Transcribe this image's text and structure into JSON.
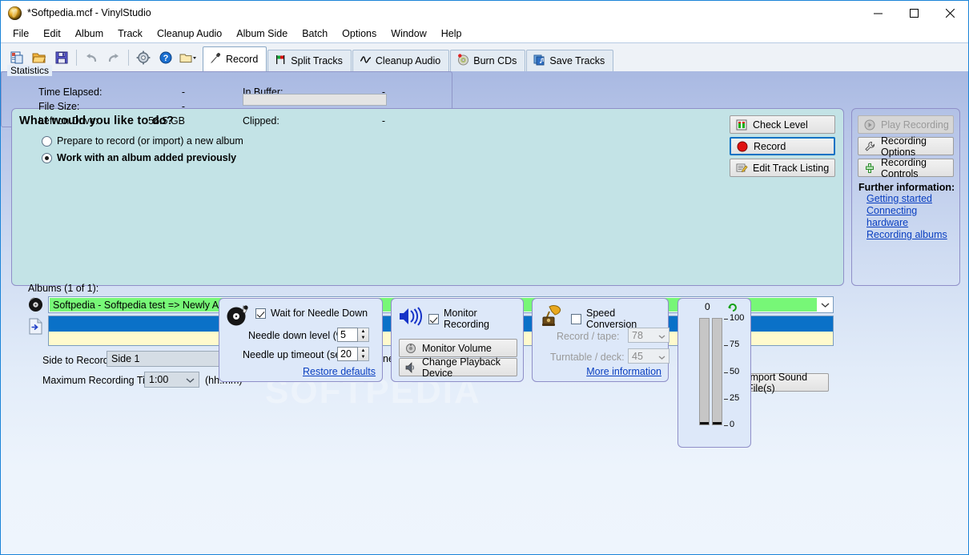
{
  "window": {
    "title": "*Softpedia.mcf - VinylStudio",
    "app_icon": "vinyl-record-icon",
    "minimize": "–",
    "maximize": "□",
    "close": "×"
  },
  "menubar": {
    "items": [
      "File",
      "Edit",
      "Album",
      "Track",
      "Cleanup Audio",
      "Album Side",
      "Batch",
      "Options",
      "Window",
      "Help"
    ]
  },
  "toolbar": {
    "icons": [
      "new-document-icon",
      "open-folder-icon",
      "save-disk-icon",
      "undo-icon",
      "redo-icon",
      "settings-gear-icon",
      "help-question-icon",
      "folder-dropdown-icon"
    ],
    "tabs": [
      {
        "label": "Record",
        "icon": "microphone-icon",
        "active": true
      },
      {
        "label": "Split Tracks",
        "icon": "flags-icon",
        "active": false
      },
      {
        "label": "Cleanup Audio",
        "icon": "waveform-icon",
        "active": false
      },
      {
        "label": "Burn CDs",
        "icon": "cd-burn-icon",
        "active": false
      },
      {
        "label": "Save Tracks",
        "icon": "save-tracks-icon",
        "active": false
      }
    ]
  },
  "task_panel": {
    "heading": "What would you like to do?",
    "option_new": "Prepare to record (or import) a new album",
    "option_existing": "Work with an album added previously",
    "albums_label": "Albums (1 of 1):",
    "album_selected": "Softpedia - Softpedia test => Newly Added",
    "side_to_record_label": "Side to Record:",
    "side_to_record_value": "Side 1",
    "record_all_sides_label": "Record all sides as one file",
    "max_recording_time_label": "Maximum Recording Time:",
    "max_recording_time_value": "1:00",
    "hhmm": "(hh:mm)",
    "import_button": "Import Sound File(s)",
    "buttons": [
      {
        "label": "Check Level",
        "icon": "level-meter-icon"
      },
      {
        "label": "Record",
        "icon": "record-dot-icon"
      },
      {
        "label": "Edit Track Listing",
        "icon": "edit-list-icon"
      }
    ]
  },
  "info_panel": {
    "buttons": [
      {
        "label": "Play Recording",
        "icon": "play-icon",
        "disabled": true
      },
      {
        "label": "Recording Options",
        "icon": "wrench-icon",
        "disabled": false
      },
      {
        "label": "Recording Controls",
        "icon": "slider-icon",
        "disabled": false
      }
    ],
    "further_information": "Further information:",
    "links": [
      "Getting started",
      "Connecting hardware",
      "Recording albums"
    ]
  },
  "needle_panel": {
    "icon": "turntable-icon",
    "checkbox_label": "Wait for Needle Down",
    "checkbox_checked": true,
    "level_label": "Needle down level (%):",
    "level_value": "5",
    "timeout_label": "Needle up timeout (sec):",
    "timeout_value": "20",
    "restore_link": "Restore defaults"
  },
  "monitor_panel": {
    "icon": "speaker-icon",
    "checkbox_label": "Monitor Recording",
    "checkbox_checked": true,
    "volume_button": "Monitor Volume",
    "volume_icon": "volume-knob-icon",
    "device_button": "Change Playback Device",
    "device_icon": "speaker-small-icon"
  },
  "speed_panel": {
    "icon": "gramophone-icon",
    "checkbox_label": "Speed Conversion",
    "checkbox_checked": false,
    "record_label": "Record / tape:",
    "record_value": "78",
    "turntable_label": "Turntable / deck:",
    "turntable_value": "45",
    "more_info_link": "More information"
  },
  "meter_panel": {
    "value": "0",
    "reset_icon": "reset-arrow-icon",
    "scale": [
      "100",
      "75",
      "50",
      "25",
      "0"
    ]
  },
  "statistics": {
    "title": "Statistics",
    "rows_left": [
      {
        "label": "Time Elapsed:",
        "value": "-"
      },
      {
        "label": "File Size:",
        "value": "-"
      },
      {
        "label": "Left on Drive:",
        "value": "56.5 GB"
      }
    ],
    "rows_right": [
      {
        "label": "In Buffer:",
        "value": "-"
      },
      {
        "label": "Clipped:",
        "value": "-"
      }
    ]
  },
  "watermark": "SOFTPEDIA",
  "colors": {
    "accent": "#0a72c4",
    "panel_teal": "#c3e3e6",
    "album_green": "#77f777",
    "listbox_yellow": "#fffacd",
    "selection_blue": "#0a71c8",
    "link": "#0a3fc0"
  }
}
